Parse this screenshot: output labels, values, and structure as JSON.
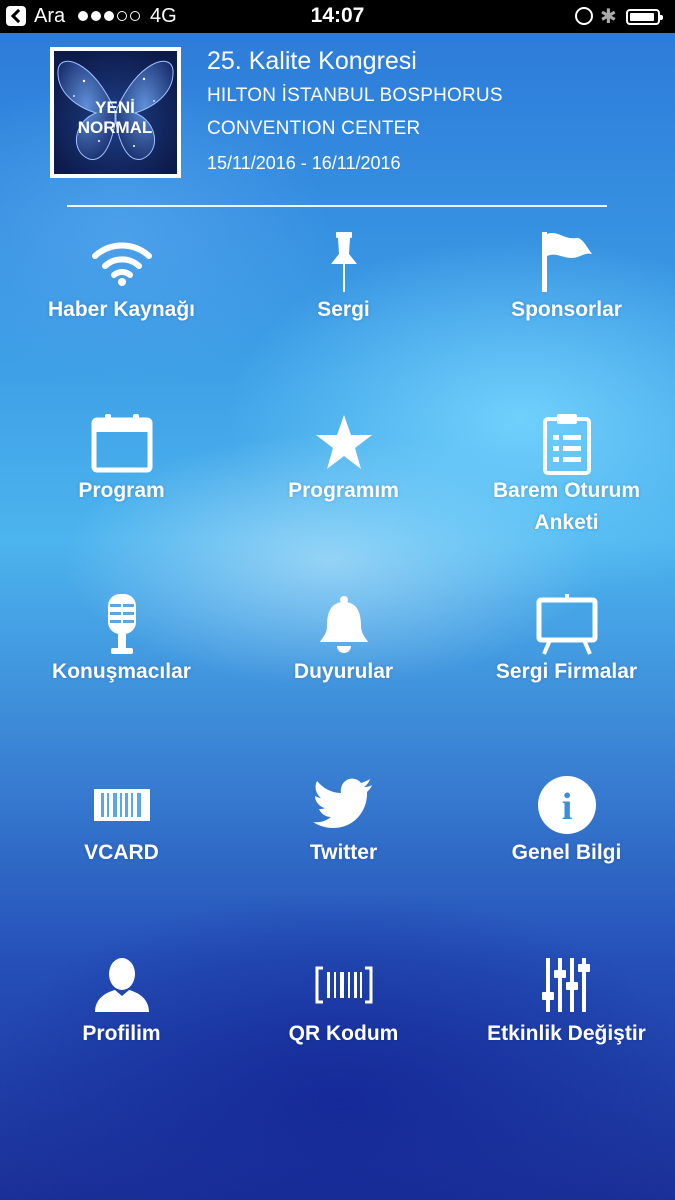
{
  "status_bar": {
    "back_label": "Ara",
    "network": "4G",
    "time": "14:07"
  },
  "header": {
    "logo_text_line1": "YENİ",
    "logo_text_line2": "NORMAL",
    "title": "25. Kalite Kongresi",
    "venue_line1": "HILTON İSTANBUL BOSPHORUS",
    "venue_line2": "CONVENTION CENTER",
    "dates": "15/11/2016 - 16/11/2016"
  },
  "menu": [
    {
      "label": "Haber Kaynağı",
      "icon": "wifi-icon"
    },
    {
      "label": "Sergi",
      "icon": "pushpin-icon"
    },
    {
      "label": "Sponsorlar",
      "icon": "flag-icon"
    },
    {
      "label": "Program",
      "icon": "calendar-icon"
    },
    {
      "label": "Programım",
      "icon": "star-icon"
    },
    {
      "label": "Barem Oturum",
      "label2": "Anketi",
      "icon": "clipboard-icon"
    },
    {
      "label": "Konuşmacılar",
      "icon": "microphone-icon"
    },
    {
      "label": "Duyurular",
      "icon": "bell-icon"
    },
    {
      "label": "Sergi Firmalar",
      "icon": "easel-icon"
    },
    {
      "label": "VCARD",
      "icon": "vcard-barcode-icon"
    },
    {
      "label": "Twitter",
      "icon": "twitter-bird-icon"
    },
    {
      "label": "Genel Bilgi",
      "icon": "info-icon"
    },
    {
      "label": "Profilim",
      "icon": "user-icon"
    },
    {
      "label": "QR Kodum",
      "icon": "qr-code-icon"
    },
    {
      "label": "Etkinlik Değiştir",
      "icon": "sliders-icon"
    }
  ],
  "colors": {
    "status_bar": "#000000",
    "text": "#ffffff",
    "bg_top": "#2b78d8",
    "bg_bottom": "#1b2f98"
  }
}
